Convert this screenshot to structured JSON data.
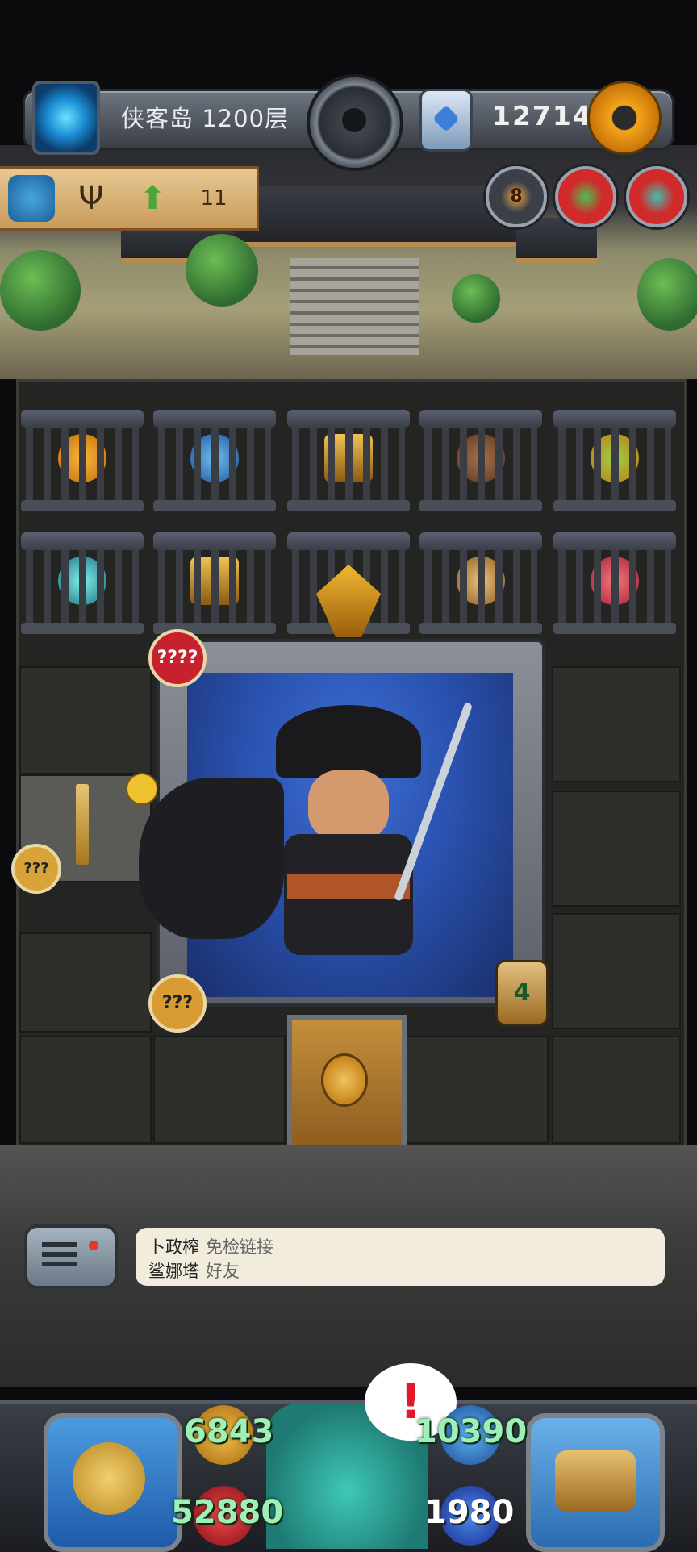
{
  "header": {
    "floor_label": "侠客岛 1200层",
    "currency_value": "127141",
    "icons": [
      "portal-icon",
      "center-gear-icon",
      "emblem-icon",
      "settings-gear-icon"
    ]
  },
  "scroll_banner": {
    "icons": [
      "shell-icon",
      "trident-icon",
      "up-arrow-icon",
      "wing-icon"
    ],
    "wing_count": "11"
  },
  "round_badges": [
    {
      "name": "coin-badge",
      "label": "8",
      "color": "#f2a64a"
    },
    {
      "name": "green-monster-badge",
      "label": "",
      "color": "#d12a2a"
    },
    {
      "name": "teal-monster-badge",
      "label": "",
      "color": "#d12a2a"
    }
  ],
  "dungeon": {
    "card_top_badge": "????",
    "card_bottom_badge": "???",
    "side_item_badge": "???",
    "timer_value": "4",
    "cage_items_row1": [
      "orange-fruit",
      "blue-orb",
      "golden-chest",
      "brown-pot",
      "green-fruit"
    ],
    "cage_items_row2": [
      "teal-orb",
      "golden-chest",
      "empty",
      "treasure-bag",
      "red-shell"
    ]
  },
  "chat": {
    "lines": [
      {
        "name": "卜政榨",
        "message": "免检链接"
      },
      {
        "name": "鲨娜塔",
        "message": "好友"
      }
    ]
  },
  "hud": {
    "attack": "6843",
    "defense": "10390",
    "hp": "52880",
    "mp": "1980",
    "alert": "!"
  },
  "colors": {
    "accent_gold": "#f4a51a",
    "stat_green": "#9ff0b6",
    "card_blue": "#2a52b0"
  }
}
